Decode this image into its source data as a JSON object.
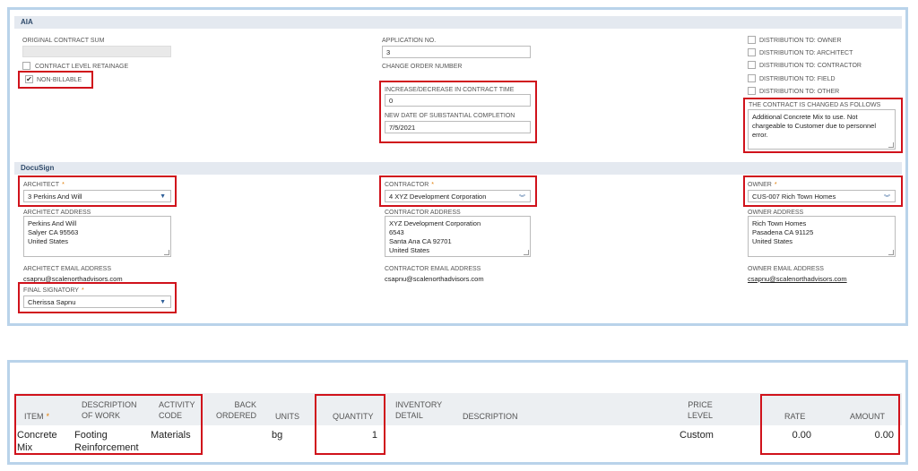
{
  "aia": {
    "header": "AIA",
    "original_contract_sum_label": "ORIGINAL CONTRACT SUM",
    "original_contract_sum_value": "",
    "contract_level_retainage_label": "CONTRACT LEVEL RETAINAGE",
    "non_billable_label": "NON-BILLABLE",
    "non_billable_checked": true,
    "application_no_label": "APPLICATION NO.",
    "application_no_value": "3",
    "change_order_number_label": "CHANGE ORDER NUMBER",
    "increase_label": "INCREASE/DECREASE IN CONTRACT TIME",
    "increase_value": "0",
    "completion_label": "NEW DATE OF SUBSTANTIAL COMPLETION",
    "completion_value": "7/5/2021",
    "distribution": [
      "DISTRIBUTION TO: OWNER",
      "DISTRIBUTION TO: ARCHITECT",
      "DISTRIBUTION TO: CONTRACTOR",
      "DISTRIBUTION TO: FIELD",
      "DISTRIBUTION TO: OTHER"
    ],
    "changed_label": "THE CONTRACT IS CHANGED AS FOLLOWS",
    "changed_lines": [
      "Additional Concrete Mix to use. Not",
      "chargeable to Customer due to personnel",
      "error."
    ]
  },
  "docusign": {
    "header": "DocuSign",
    "architect_label": "ARCHITECT",
    "architect_value": "3 Perkins And Will",
    "architect_address_label": "ARCHITECT ADDRESS",
    "architect_address": [
      "Perkins And Will",
      "Salyer CA 95563",
      "United States"
    ],
    "architect_email_label": "ARCHITECT EMAIL ADDRESS",
    "architect_email": "csapnu@scalenorthadvisors.com",
    "final_signatory_label": "FINAL SIGNATORY",
    "final_signatory_value": "Cherissa Sapnu",
    "contractor_label": "CONTRACTOR",
    "contractor_value": "4 XYZ Development Corporation",
    "contractor_address_label": "CONTRACTOR ADDRESS",
    "contractor_address": [
      "XYZ Development Corporation",
      "6543",
      "Santa Ana CA 92701",
      "United States"
    ],
    "contractor_email_label": "CONTRACTOR EMAIL ADDRESS",
    "contractor_email": "csapnu@scalenorthadvisors.com",
    "owner_label": "OWNER",
    "owner_value": "CUS-007 Rich Town Homes",
    "owner_address_label": "OWNER ADDRESS",
    "owner_address": [
      "Rich Town Homes",
      "Pasadena CA 91125",
      "United States"
    ],
    "owner_email_label": "OWNER EMAIL ADDRESS",
    "owner_email": "csapnu@scalenorthadvisors.com"
  },
  "items_table": {
    "headers": {
      "item": "ITEM",
      "description_of_work": [
        "DESCRIPTION",
        "OF WORK"
      ],
      "activity_code": [
        "ACTIVITY",
        "CODE"
      ],
      "back_ordered": [
        "BACK",
        "ORDERED"
      ],
      "units": "UNITS",
      "quantity": "QUANTITY",
      "inventory_detail": [
        "INVENTORY",
        "DETAIL"
      ],
      "description": "DESCRIPTION",
      "price_level": [
        "PRICE",
        "LEVEL"
      ],
      "rate": "RATE",
      "amount": "AMOUNT"
    },
    "row": {
      "item": [
        "Concrete",
        "Mix"
      ],
      "description_of_work": [
        "Footing",
        "Reinforcement"
      ],
      "activity_code": "Materials",
      "units": "bg",
      "quantity": "1",
      "price_level": "Custom",
      "rate": "0.00",
      "amount": "0.00"
    }
  },
  "icons": {
    "dropdown": "chevron-down-icon",
    "double_dropdown": "double-chevron-down-icon",
    "checkmark": "checkmark-icon",
    "required": "asterisk-icon"
  },
  "colors": {
    "highlight": "#d0121b",
    "panel_border": "#b9d3ea",
    "section_header": "#e4e9f0",
    "required": "#e07b00"
  }
}
